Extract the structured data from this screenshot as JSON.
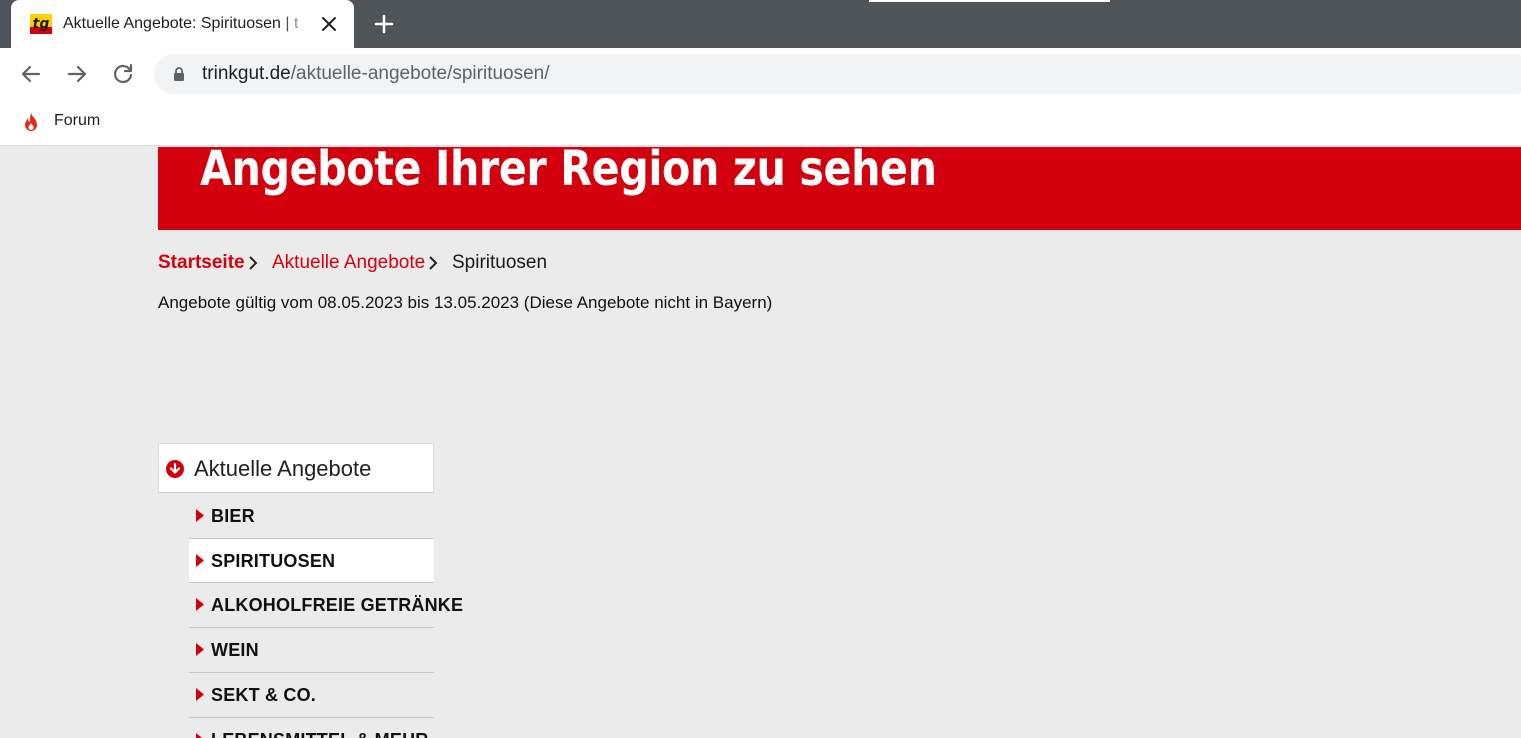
{
  "browser": {
    "tab": {
      "title": "Aktuelle Angebote: Spirituosen | t",
      "favicon_text": "tg"
    },
    "address": {
      "host": "trinkgut.de",
      "path": "/aktuelle-angebote/spirituosen/"
    },
    "bookmarks": [
      {
        "label": "Forum",
        "icon": "flame-icon"
      }
    ],
    "icons": {
      "back": "arrow-left-icon",
      "forward": "arrow-right-icon",
      "reload": "reload-icon",
      "lock": "lock-icon",
      "close": "close-icon",
      "new_tab": "plus-icon"
    }
  },
  "page": {
    "banner_text": "Angebote Ihrer Region zu sehen",
    "breadcrumb": {
      "home": "Startseite",
      "offers": "Aktuelle Angebote",
      "current": "Spirituosen"
    },
    "validity": "Angebote gültig vom 08.05.2023 bis 13.05.2023 (Diese Angebote nicht in Bayern)",
    "side_nav": {
      "header": "Aktuelle Angebote",
      "items": [
        {
          "label": "BIER",
          "active": false
        },
        {
          "label": "SPIRITUOSEN",
          "active": true
        },
        {
          "label": "ALKOHOLFREIE GETRÄNKE",
          "active": false
        },
        {
          "label": "WEIN",
          "active": false
        },
        {
          "label": "SEKT & CO.",
          "active": false
        },
        {
          "label": "LEBENSMITTEL & MEHR",
          "active": false
        }
      ]
    }
  },
  "colors": {
    "brand_red": "#d3000d",
    "tabstrip": "#4e545a",
    "page_background": "#ebebeb"
  }
}
